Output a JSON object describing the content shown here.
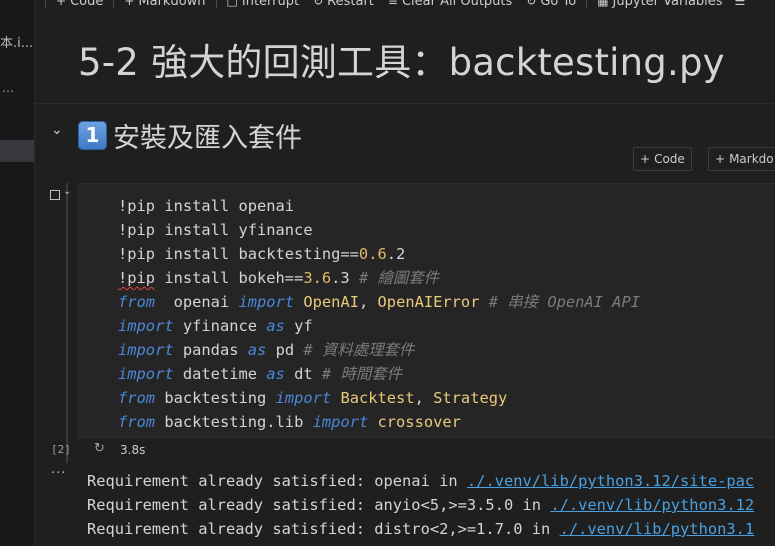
{
  "toolbar": {
    "items": [
      {
        "icon": "plus-icon",
        "label": "Code"
      },
      {
        "icon": "plus-icon",
        "label": "Markdown"
      },
      {
        "icon": "interrupt-icon",
        "label": "Interrupt"
      },
      {
        "icon": "restart-icon",
        "label": "Restart"
      },
      {
        "icon": "clear-outputs-icon",
        "label": "Clear All Outputs"
      },
      {
        "icon": "go-to-icon",
        "label": "Go To"
      },
      {
        "icon": "variables-icon",
        "label": "Jupyter Variables"
      }
    ]
  },
  "left_panel": {
    "fragment": "本.i...",
    "dots": "⋯"
  },
  "title": "5-2 強大的回測工具：backtesting.py",
  "section": {
    "emoji": "1",
    "heading": "安裝及匯入套件"
  },
  "add_buttons": {
    "code": "Code",
    "markdown": "Markdo"
  },
  "cell": {
    "code_lines": [
      [
        {
          "t": "!pip install openai",
          "c": ""
        }
      ],
      [
        {
          "t": "!pip install yfinance",
          "c": ""
        }
      ],
      [
        {
          "t": "!pip install backtesting==",
          "c": ""
        },
        {
          "t": "0.6",
          "c": "num"
        },
        {
          "t": ".2",
          "c": ""
        }
      ],
      [
        {
          "t": "!pip",
          "c": "wavy"
        },
        {
          "t": " install bokeh==",
          "c": ""
        },
        {
          "t": "3.6",
          "c": "num"
        },
        {
          "t": ".3 ",
          "c": ""
        },
        {
          "t": "# 繪圖套件",
          "c": "cm"
        }
      ],
      [
        {
          "t": "from",
          "c": "kw"
        },
        {
          "t": "  openai ",
          "c": ""
        },
        {
          "t": "import",
          "c": "kw"
        },
        {
          "t": " ",
          "c": ""
        },
        {
          "t": "OpenAI",
          "c": "cls"
        },
        {
          "t": ", ",
          "c": ""
        },
        {
          "t": "OpenAIError",
          "c": "cls"
        },
        {
          "t": " # 串接 OpenAI API",
          "c": "cm"
        }
      ],
      [
        {
          "t": "import",
          "c": "kw"
        },
        {
          "t": " yfinance ",
          "c": ""
        },
        {
          "t": "as",
          "c": "kw"
        },
        {
          "t": " yf",
          "c": ""
        }
      ],
      [
        {
          "t": "import",
          "c": "kw"
        },
        {
          "t": " pandas ",
          "c": ""
        },
        {
          "t": "as",
          "c": "kw"
        },
        {
          "t": " pd ",
          "c": ""
        },
        {
          "t": "# 資料處理套件",
          "c": "cm"
        }
      ],
      [
        {
          "t": "import",
          "c": "kw"
        },
        {
          "t": " datetime ",
          "c": ""
        },
        {
          "t": "as",
          "c": "kw"
        },
        {
          "t": " dt ",
          "c": ""
        },
        {
          "t": "# 時間套件",
          "c": "cm"
        }
      ],
      [
        {
          "t": "from",
          "c": "kw"
        },
        {
          "t": " backtesting ",
          "c": ""
        },
        {
          "t": "import",
          "c": "kw"
        },
        {
          "t": " ",
          "c": ""
        },
        {
          "t": "Backtest",
          "c": "cls"
        },
        {
          "t": ", ",
          "c": ""
        },
        {
          "t": "Strategy",
          "c": "cls"
        }
      ],
      [
        {
          "t": "from",
          "c": "kw"
        },
        {
          "t": " backtesting.lib ",
          "c": ""
        },
        {
          "t": "import",
          "c": "kw"
        },
        {
          "t": " ",
          "c": ""
        },
        {
          "t": "crossover",
          "c": "cls"
        }
      ]
    ],
    "execution_count": "[2]",
    "exec_time": "3.8s"
  },
  "output": {
    "more": "···",
    "lines": [
      {
        "prefix": "Requirement already satisfied: openai in ",
        "link": "./.venv/lib/python3.12/site-pac"
      },
      {
        "prefix": "Requirement already satisfied: anyio<5,>=3.5.0 in ",
        "link": "./.venv/lib/python3.12"
      },
      {
        "prefix": "Requirement already satisfied: distro<2,>=1.7.0 in ",
        "link": "./.venv/lib/python3.1"
      }
    ]
  },
  "colors": {
    "keyword": "#4b87d6",
    "class": "#eac97a",
    "number": "#e2b86b",
    "comment": "#7b7b7b",
    "link": "#4aa0e0"
  }
}
